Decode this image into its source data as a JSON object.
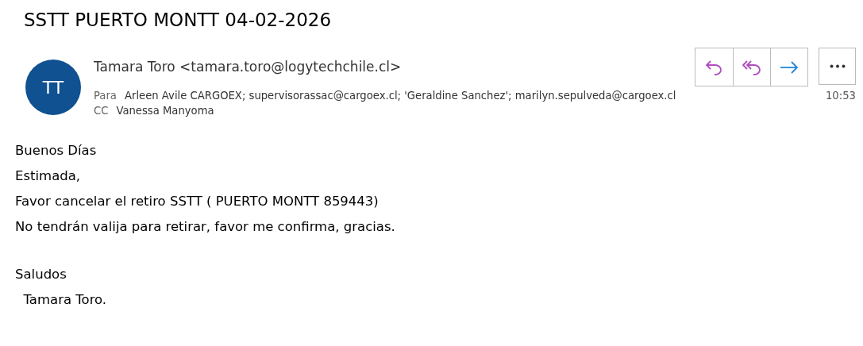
{
  "subject": "SSTT PUERTO MONTT 04-02-2026",
  "sender": {
    "initials": "TT",
    "name": "Tamara Toro <tamara.toro@logytechchile.cl>"
  },
  "actions": [
    {
      "kind": "reply"
    },
    {
      "kind": "reply-all"
    },
    {
      "kind": "forward"
    },
    {
      "kind": "more"
    }
  ],
  "to": {
    "label": "Para",
    "value": "Arleen Avile CARGOEX; supervisorassac@cargoex.cl; 'Geraldine Sanchez'; marilyn.sepulveda@cargoex.cl"
  },
  "time": "10:53",
  "cc": {
    "label": "CC",
    "value": "Vanessa Manyoma"
  },
  "body": [
    [
      "Buenos Días",
      "Estimada,",
      "Favor cancelar el retiro SSTT ( PUERTO MONTT 859443)",
      "No tendrán valija para retirar, favor me confirma, gracias."
    ],
    [
      "Saludos",
      "  Tamara Toro."
    ]
  ]
}
